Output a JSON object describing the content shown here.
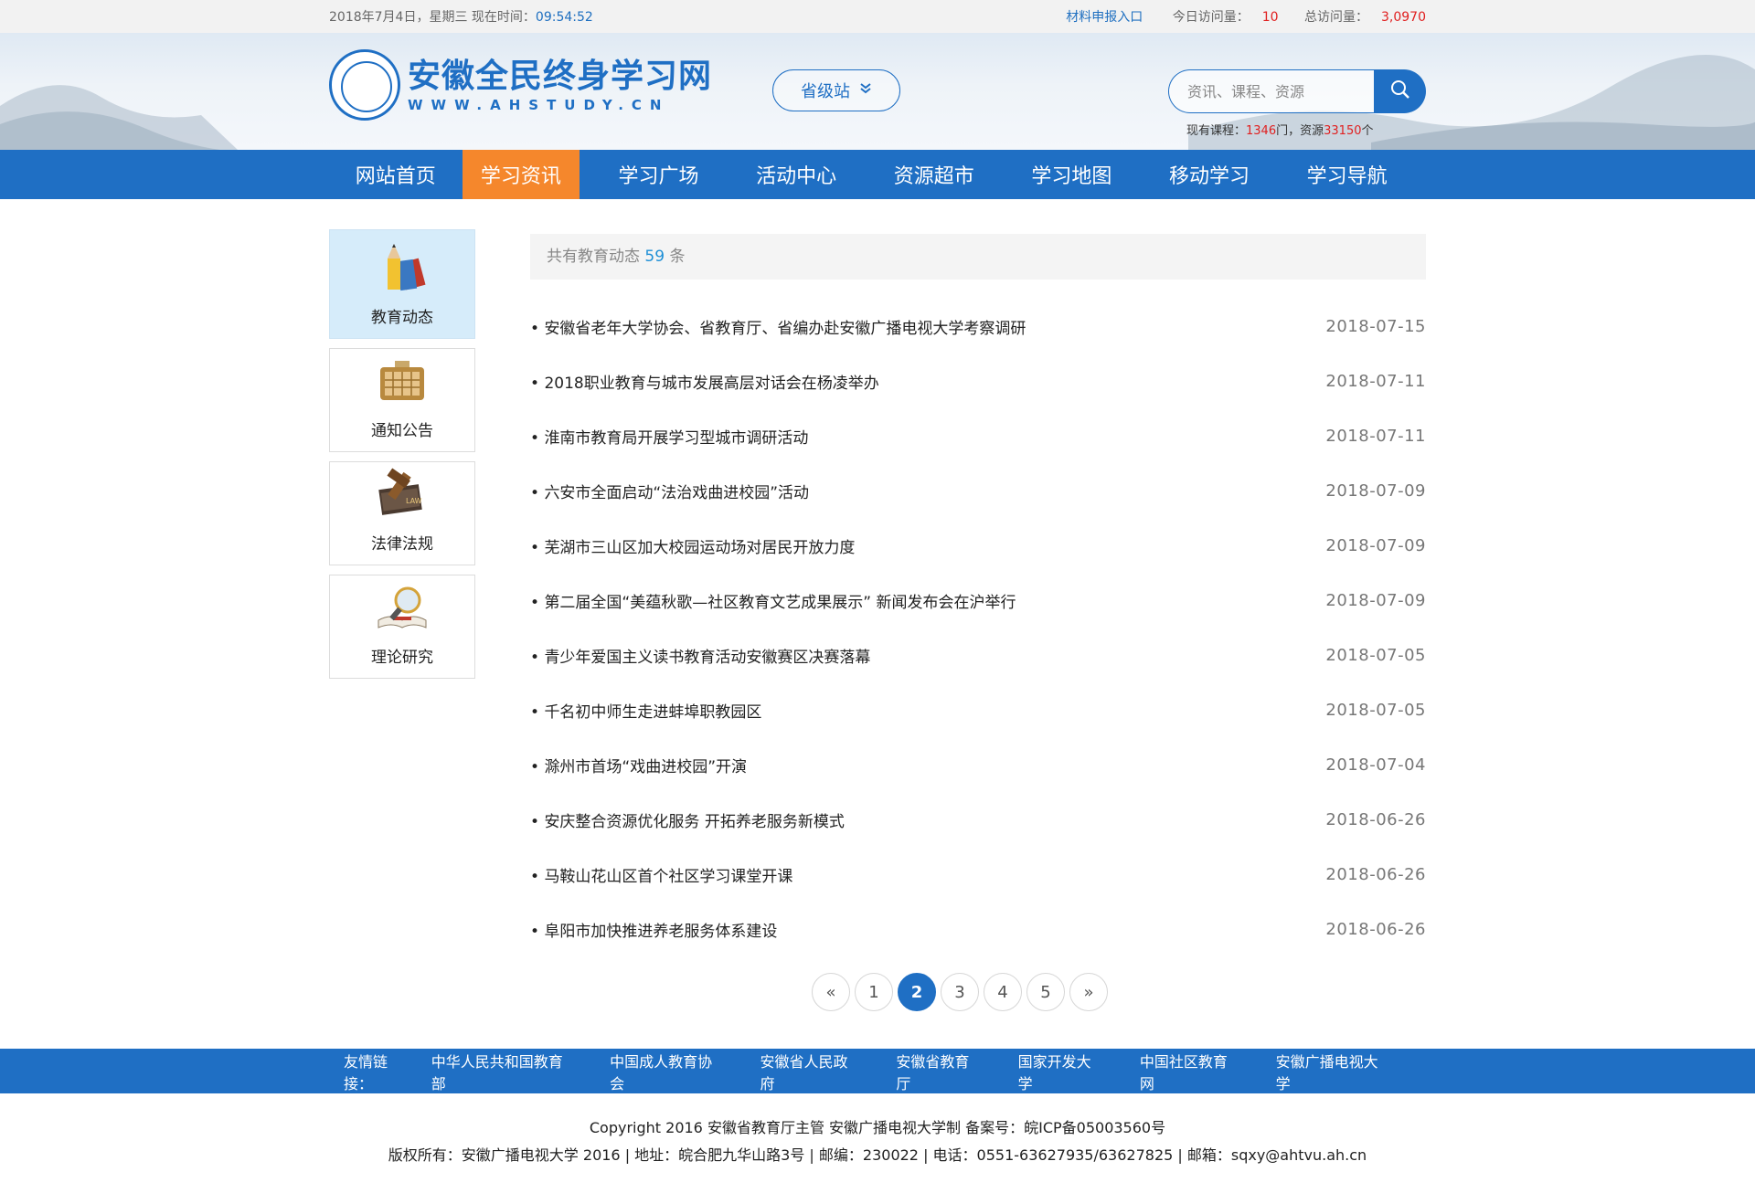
{
  "topbar": {
    "date_text": "2018年7月4日，星期三 现在时间：",
    "time": "09:54:52",
    "report_link": "材料申报入口",
    "today_label": "今日访问量：",
    "today_count": "10",
    "total_label": "总访问量：",
    "total_count": "3,0970"
  },
  "header": {
    "logo_title": "安徽全民终身学习网",
    "logo_url": "WWW.AHSTUDY.CN",
    "site_button": "省级站",
    "search_placeholder": "资讯、课程、资源",
    "stats_prefix": "现有课程：",
    "course_count": "1346",
    "stats_mid": "门，资源",
    "resource_count": "33150",
    "stats_suffix": "个"
  },
  "nav": {
    "items": [
      {
        "label": "网站首页"
      },
      {
        "label": "学习资讯"
      },
      {
        "label": "学习广场"
      },
      {
        "label": "活动中心"
      },
      {
        "label": "资源超市"
      },
      {
        "label": "学习地图"
      },
      {
        "label": "移动学习"
      },
      {
        "label": "学习导航"
      }
    ],
    "active_index": 1
  },
  "sidebar": {
    "items": [
      {
        "label": "教育动态",
        "icon": "pencil-books-icon"
      },
      {
        "label": "通知公告",
        "icon": "notice-board-icon"
      },
      {
        "label": "法律法规",
        "icon": "law-book-gavel-icon"
      },
      {
        "label": "理论研究",
        "icon": "magnifier-book-icon"
      }
    ]
  },
  "content": {
    "count_prefix": "共有教育动态",
    "count": "59",
    "count_suffix": "条",
    "news": [
      {
        "title": "安徽省老年大学协会、省教育厅、省编办赴安徽广播电视大学考察调研",
        "date": "2018-07-15"
      },
      {
        "title": "2018职业教育与城市发展高层对话会在杨凌举办",
        "date": "2018-07-11"
      },
      {
        "title": "淮南市教育局开展学习型城市调研活动",
        "date": "2018-07-11"
      },
      {
        "title": "六安市全面启动“法治戏曲进校园”活动",
        "date": "2018-07-09"
      },
      {
        "title": "芜湖市三山区加大校园运动场对居民开放力度",
        "date": "2018-07-09"
      },
      {
        "title": "第二届全国“美蕴秋歌—社区教育文艺成果展示” 新闻发布会在沪举行",
        "date": "2018-07-09"
      },
      {
        "title": "青少年爱国主义读书教育活动安徽赛区决赛落幕",
        "date": "2018-07-05"
      },
      {
        "title": "千名初中师生走进蚌埠职教园区",
        "date": "2018-07-05"
      },
      {
        "title": "滁州市首场“戏曲进校园”开演",
        "date": "2018-07-04"
      },
      {
        "title": "安庆整合资源优化服务 开拓养老服务新模式",
        "date": "2018-06-26"
      },
      {
        "title": "马鞍山花山区首个社区学习课堂开课",
        "date": "2018-06-26"
      },
      {
        "title": "阜阳市加快推进养老服务体系建设",
        "date": "2018-06-26"
      }
    ]
  },
  "pager": {
    "prev": "«",
    "next": "»",
    "pages": [
      "1",
      "2",
      "3",
      "4",
      "5"
    ],
    "current": "2"
  },
  "links": {
    "label": "友情链接：",
    "items": [
      "中华人民共和国教育部",
      "中国成人教育协会",
      "安徽省人民政府",
      "安徽省教育厅",
      "国家开发大学",
      "中国社区教育网",
      "安徽广播电视大学"
    ]
  },
  "footer": {
    "line1": "Copyright 2016 安徽省教育厅主管 安徽广播电视大学制 备案号：皖ICP备05003560号",
    "line2": "版权所有：安徽广播电视大学 2016 | 地址：皖合肥九华山路3号 | 邮编：230022 | 电话：0551-63627935/63627825 | 邮箱：sqxy@ahtvu.ah.cn"
  },
  "colors": {
    "brand_blue": "#1f6fc4",
    "active_orange": "#f5872c",
    "highlight_red": "#e02020"
  }
}
